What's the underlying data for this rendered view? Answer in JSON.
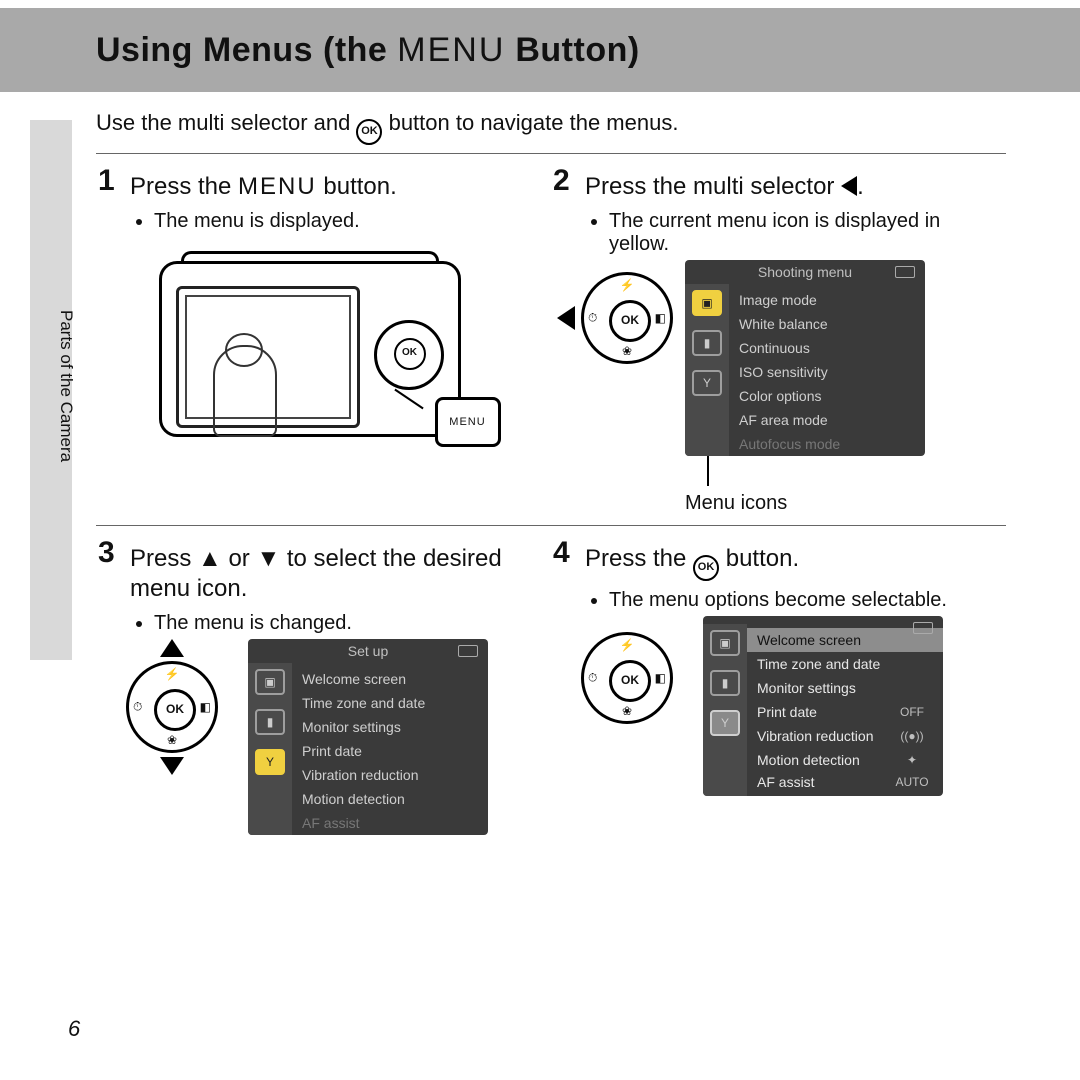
{
  "title_prefix": "Using Menus (the ",
  "title_menu_glyph": "MENU",
  "title_suffix": " Button)",
  "intro_prefix": "Use the multi selector and ",
  "intro_ok_glyph": "OK",
  "intro_suffix": " button to navigate the menus.",
  "side_label": "Parts of the Camera",
  "steps": {
    "s1": {
      "num": "1",
      "title_prefix": "Press the ",
      "title_glyph": "MENU",
      "title_suffix": " button.",
      "bullet": "The menu is displayed."
    },
    "s2": {
      "num": "2",
      "title_prefix": "Press the multi selector ",
      "title_suffix": ".",
      "bullet": "The current menu icon is displayed in yellow.",
      "lcd_title": "Shooting menu",
      "items": [
        "Image mode",
        "White balance",
        "Continuous",
        "ISO sensitivity",
        "Color options",
        "AF area mode"
      ],
      "cut_item": "Autofocus mode",
      "caption": "Menu icons"
    },
    "s3": {
      "num": "3",
      "title": "Press ▲ or ▼ to select the desired menu icon.",
      "bullet": "The menu is changed.",
      "lcd_title": "Set up",
      "items": [
        "Welcome screen",
        "Time zone and date",
        "Monitor settings",
        "Print date",
        "Vibration reduction",
        "Motion detection"
      ],
      "cut_item": "AF assist"
    },
    "s4": {
      "num": "4",
      "title_prefix": "Press the ",
      "title_suffix": " button.",
      "bullet": "The menu options become selectable.",
      "items": [
        {
          "label": "Welcome screen",
          "val": ""
        },
        {
          "label": "Time zone and date",
          "val": ""
        },
        {
          "label": "Monitor settings",
          "val": ""
        },
        {
          "label": "Print date",
          "val": "OFF"
        },
        {
          "label": "Vibration reduction",
          "val": "((●))"
        },
        {
          "label": "Motion detection",
          "val": "✦"
        }
      ],
      "cut_item": "AF assist",
      "cut_val": "AUTO"
    }
  },
  "ok_label": "OK",
  "menu_label": "MENU",
  "icons": {
    "cam": "▣",
    "vid": "▮",
    "wrench": "Y"
  },
  "page_number": "6"
}
